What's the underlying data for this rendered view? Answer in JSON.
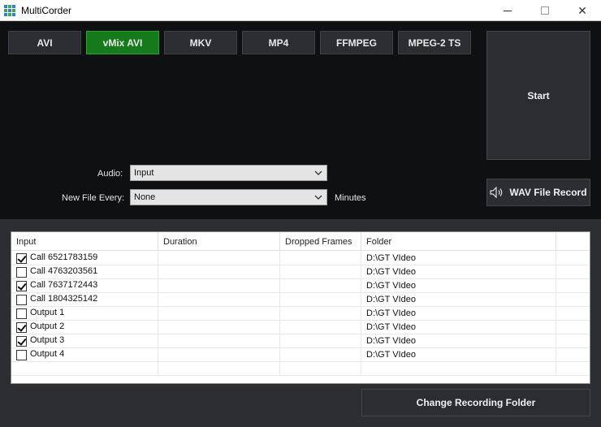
{
  "window": {
    "title": "MultiCorder"
  },
  "formats": [
    {
      "label": "AVI",
      "active": false
    },
    {
      "label": "vMix AVI",
      "active": true
    },
    {
      "label": "MKV",
      "active": false
    },
    {
      "label": "MP4",
      "active": false
    },
    {
      "label": "FFMPEG",
      "active": false
    },
    {
      "label": "MPEG-2 TS",
      "active": false
    }
  ],
  "start_label": "Start",
  "wav_label": "WAV File Record",
  "audio": {
    "label": "Audio:",
    "value": "Input"
  },
  "new_file": {
    "label": "New File Every:",
    "value": "None",
    "unit": "Minutes"
  },
  "table": {
    "columns": [
      "Input",
      "Duration",
      "Dropped Frames",
      "Folder"
    ],
    "rows": [
      {
        "checked": true,
        "input": "Call 6521783159",
        "duration": "",
        "dropped": "",
        "folder": "D:\\GT VIdeo"
      },
      {
        "checked": false,
        "input": "Call 4763203561",
        "duration": "",
        "dropped": "",
        "folder": "D:\\GT VIdeo"
      },
      {
        "checked": true,
        "input": "Call 7637172443",
        "duration": "",
        "dropped": "",
        "folder": "D:\\GT VIdeo"
      },
      {
        "checked": false,
        "input": "Call 1804325142",
        "duration": "",
        "dropped": "",
        "folder": "D:\\GT VIdeo"
      },
      {
        "checked": false,
        "input": "Output 1",
        "duration": "",
        "dropped": "",
        "folder": "D:\\GT VIdeo"
      },
      {
        "checked": true,
        "input": "Output 2",
        "duration": "",
        "dropped": "",
        "folder": "D:\\GT VIdeo"
      },
      {
        "checked": true,
        "input": "Output 3",
        "duration": "",
        "dropped": "",
        "folder": "D:\\GT VIdeo"
      },
      {
        "checked": false,
        "input": "Output 4",
        "duration": "",
        "dropped": "",
        "folder": "D:\\GT VIdeo"
      }
    ]
  },
  "change_folder_label": "Change Recording Folder",
  "colors": {
    "active_format": "#157a1b",
    "panel_dark": "#0f1012",
    "panel": "#2c2e32"
  }
}
